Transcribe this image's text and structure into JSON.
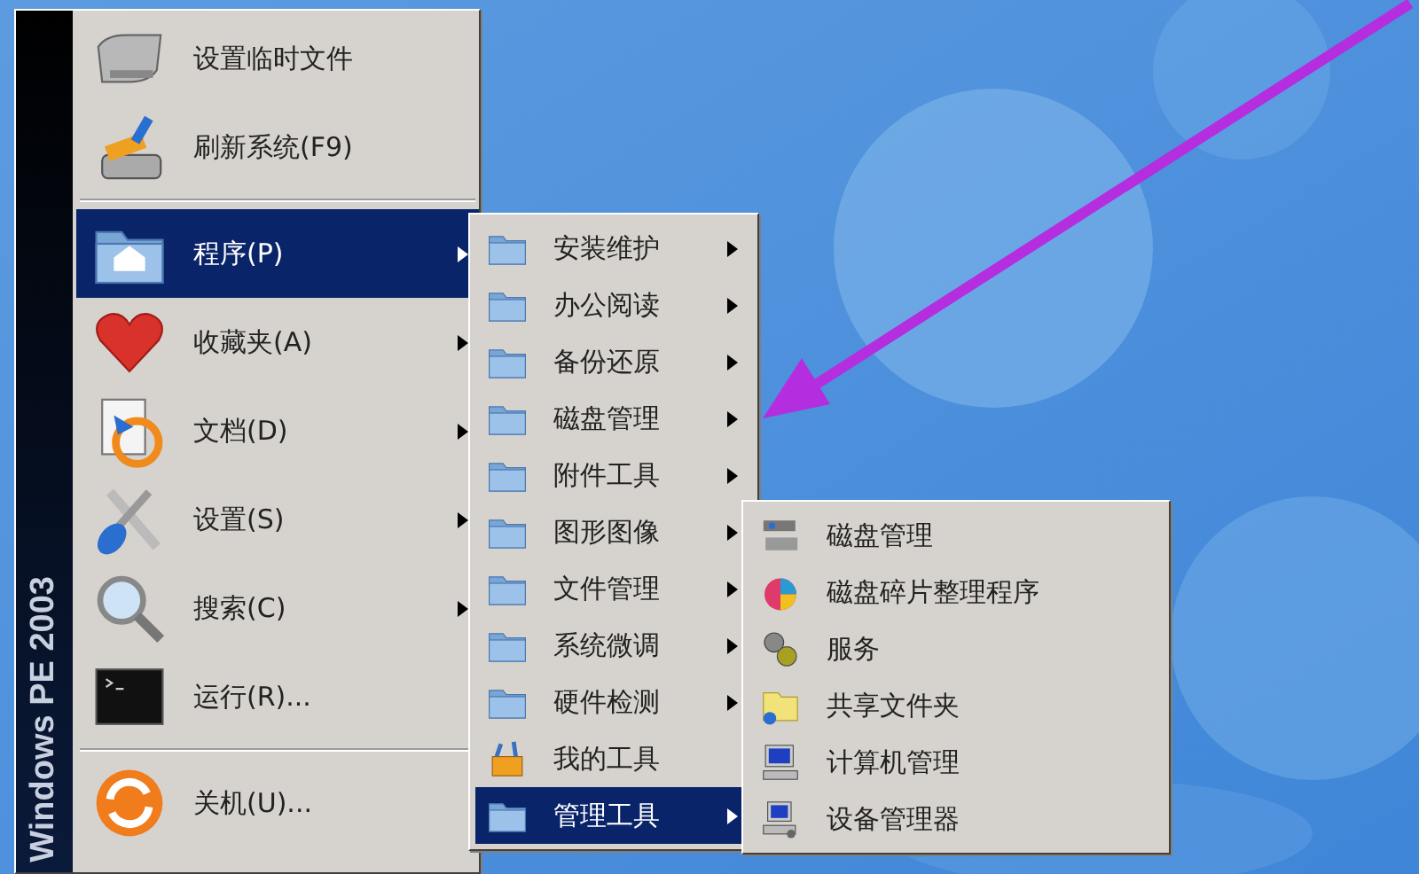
{
  "start_menu": {
    "sidebar_label": "Windows PE 2003",
    "items": [
      {
        "label": "设置临时文件",
        "has_submenu": false,
        "selected": false,
        "separator_before": false
      },
      {
        "label": "刷新系统(F9)",
        "has_submenu": false,
        "selected": false,
        "separator_before": false
      },
      {
        "label": "程序(P)",
        "has_submenu": true,
        "selected": true,
        "separator_before": true
      },
      {
        "label": "收藏夹(A)",
        "has_submenu": true,
        "selected": false,
        "separator_before": false
      },
      {
        "label": "文档(D)",
        "has_submenu": true,
        "selected": false,
        "separator_before": false
      },
      {
        "label": "设置(S)",
        "has_submenu": true,
        "selected": false,
        "separator_before": false
      },
      {
        "label": "搜索(C)",
        "has_submenu": true,
        "selected": false,
        "separator_before": false
      },
      {
        "label": "运行(R)...",
        "has_submenu": false,
        "selected": false,
        "separator_before": false
      },
      {
        "label": "关机(U)...",
        "has_submenu": false,
        "selected": false,
        "separator_before": true
      }
    ]
  },
  "programs_menu": {
    "items": [
      {
        "label": "安装维护",
        "kind": "folder",
        "has_submenu": true,
        "selected": false
      },
      {
        "label": "办公阅读",
        "kind": "folder",
        "has_submenu": true,
        "selected": false
      },
      {
        "label": "备份还原",
        "kind": "folder",
        "has_submenu": true,
        "selected": false
      },
      {
        "label": "磁盘管理",
        "kind": "folder",
        "has_submenu": true,
        "selected": false
      },
      {
        "label": "附件工具",
        "kind": "folder",
        "has_submenu": true,
        "selected": false
      },
      {
        "label": "图形图像",
        "kind": "folder",
        "has_submenu": true,
        "selected": false
      },
      {
        "label": "文件管理",
        "kind": "folder",
        "has_submenu": true,
        "selected": false
      },
      {
        "label": "系统微调",
        "kind": "folder",
        "has_submenu": true,
        "selected": false
      },
      {
        "label": "硬件检测",
        "kind": "folder",
        "has_submenu": true,
        "selected": false
      },
      {
        "label": "我的工具",
        "kind": "program",
        "has_submenu": false,
        "selected": false
      },
      {
        "label": "管理工具",
        "kind": "folder",
        "has_submenu": true,
        "selected": true
      }
    ]
  },
  "admin_tools_menu": {
    "items": [
      {
        "label": "磁盘管理",
        "selected": false
      },
      {
        "label": "磁盘碎片整理程序",
        "selected": false
      },
      {
        "label": "服务",
        "selected": false
      },
      {
        "label": "共享文件夹",
        "selected": false
      },
      {
        "label": "计算机管理",
        "selected": false
      },
      {
        "label": "设备管理器",
        "selected": false
      }
    ]
  }
}
